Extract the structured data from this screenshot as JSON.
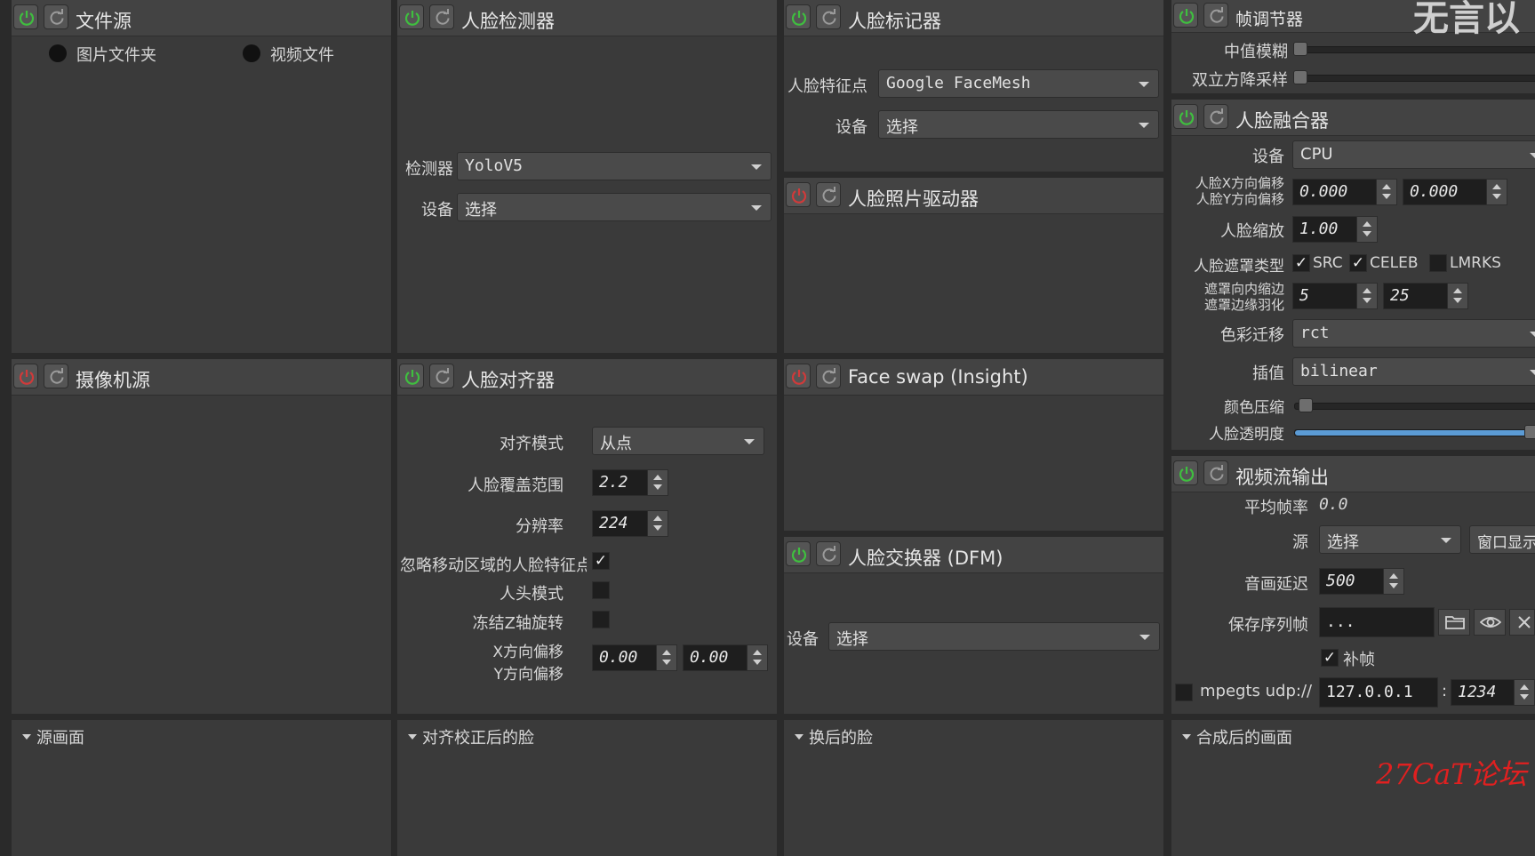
{
  "panels": {
    "file_source": {
      "title": "文件源",
      "radio_folder": "图片文件夹",
      "radio_video": "视频文件"
    },
    "face_detector": {
      "title": "人脸检测器",
      "detector_label": "检测器",
      "detector_value": "YoloV5",
      "device_label": "设备",
      "device_value": "选择"
    },
    "face_marker": {
      "title": "人脸标记器",
      "landmark_label": "人脸特征点",
      "landmark_value": "Google FaceMesh",
      "device_label": "设备",
      "device_value": "选择"
    },
    "face_photo_driver": {
      "title": "人脸照片驱动器"
    },
    "camera_source": {
      "title": "摄像机源"
    },
    "face_aligner": {
      "title": "人脸对齐器",
      "align_mode_label": "对齐模式",
      "align_mode_value": "从点",
      "coverage_label": "人脸覆盖范围",
      "coverage_value": "2.2",
      "resolution_label": "分辨率",
      "resolution_value": "224",
      "ignore_moving_label": "忽略移动区域的人脸特征点",
      "head_mode_label": "人头模式",
      "freeze_z_label": "冻结Z轴旋转",
      "x_offset_label": "X方向偏移",
      "y_offset_label": "Y方向偏移",
      "x_offset_value": "0.00",
      "y_offset_value": "0.00"
    },
    "face_swap_insight": {
      "title": "Face swap (Insight)"
    },
    "face_swapper_dfm": {
      "title": "人脸交换器 (DFM)",
      "device_label": "设备",
      "device_value": "选择"
    },
    "frame_adjuster": {
      "title": "帧调节器",
      "median_blur_label": "中值模糊",
      "bilateral_label": "双立方降采样",
      "overlay_text": "无言以"
    },
    "face_merger": {
      "title": "人脸融合器",
      "device_label": "设备",
      "device_value": "CPU",
      "x_offset_label": "人脸X方向偏移",
      "y_offset_label": "人脸Y方向偏移",
      "x_offset_value": "0.000",
      "y_offset_value": "0.000",
      "scale_label": "人脸缩放",
      "scale_value": "1.00",
      "mask_type_label": "人脸遮罩类型",
      "mask_src": "SRC",
      "mask_celeb": "CELEB",
      "mask_lmrks": "LMRKS",
      "erode_label": "遮罩向内缩边",
      "blur_label": "遮罩边缘羽化",
      "erode_value": "5",
      "blur_value": "25",
      "color_transfer_label": "色彩迁移",
      "color_transfer_value": "rct",
      "interpolation_label": "插值",
      "interpolation_value": "bilinear",
      "color_compress_label": "颜色压缩",
      "opacity_label": "人脸透明度",
      "opacity_fraction": 1.0
    },
    "stream_output": {
      "title": "视频流输出",
      "avg_fps_label": "平均帧率",
      "avg_fps_value": "0.0",
      "source_label": "源",
      "source_value": "选择",
      "window_button": "窗口显示",
      "av_delay_label": "音画延迟",
      "av_delay_value": "500",
      "save_seq_label": "保存序列帧",
      "save_seq_value": "...",
      "fill_frames_label": "补帧",
      "mpegts_label": "mpegts udp://",
      "ip_value": "127.0.0.1",
      "port_sep": ":",
      "port_value": "1234"
    }
  },
  "previews": {
    "source_frame": "源画面",
    "aligned_face": "对齐校正后的脸",
    "swapped_face": "换后的脸",
    "merged_frame": "合成后的画面"
  },
  "watermark": "27CaT论坛",
  "colors": {
    "power_on": "#3fbf3f",
    "power_off": "#d03a3a",
    "slider_fill": "#5b9bd5",
    "watermark": "#e02020"
  }
}
